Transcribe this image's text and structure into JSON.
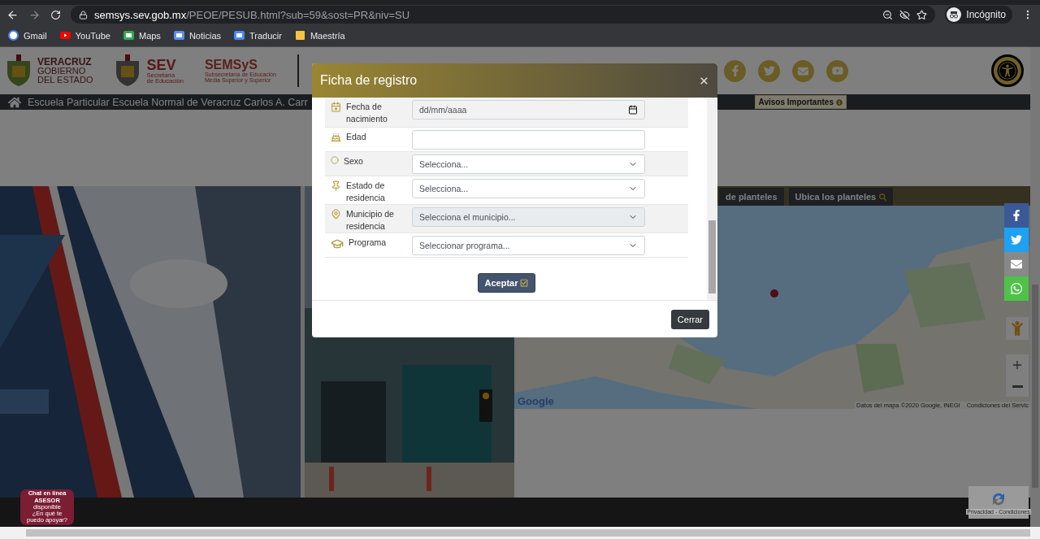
{
  "browser": {
    "url_host": "semsys.sev.gob.mx",
    "url_path": "/PEOE/PESUB.html?sub=59&sost=PR&niv=SU",
    "profile": "Incógnito",
    "bookmarks": [
      "Gmail",
      "YouTube",
      "Maps",
      "Noticias",
      "Traducir",
      "Maestría"
    ]
  },
  "header": {
    "gov": {
      "title": "VERACRUZ",
      "lines": [
        "GOBIERNO",
        "DEL ESTADO"
      ]
    },
    "sev": {
      "title": "SEV",
      "lines": [
        "Secretaría",
        "de Educación"
      ]
    },
    "semsys": {
      "title": "SEMSyS",
      "lines": [
        "Subsecretaría de Educación",
        "Media Superior y Superior"
      ]
    }
  },
  "nav": {
    "school": "Escuela Particular Escuela Normal de Veracruz Carlos A. Carr",
    "notice": "Avisos Importantes"
  },
  "map": {
    "tabs": [
      "de planteles",
      "Ubica los planteles"
    ],
    "logo": "Google",
    "attribution": "Datos del mapa ©2020 Google, INEGI",
    "terms": "Condiciones del Servic"
  },
  "modal": {
    "title": "Ficha de registro",
    "fields": [
      {
        "kind": "date",
        "label": "Fecha de nacimiento",
        "placeholder": "dd/mm/aaaa"
      },
      {
        "kind": "text",
        "label": "Edad"
      },
      {
        "kind": "select",
        "label": "Sexo",
        "value": "Selecciona...",
        "disabled": false
      },
      {
        "kind": "select",
        "label": "Estado de residencia",
        "value": "Selecciona...",
        "disabled": false
      },
      {
        "kind": "select",
        "label": "Municipio de residencia",
        "value": "Selecciona el municipio...",
        "disabled": true
      },
      {
        "kind": "select",
        "label": "Programa",
        "value": "Seleccionar programa...",
        "disabled": false
      }
    ],
    "submit": "Aceptar",
    "close": "Cerrar"
  },
  "chat": {
    "lines": [
      "**Chat en línea**",
      "**ASESOR**",
      "disponible",
      "¿En qué te",
      "puedo apoyar?"
    ]
  },
  "recaptcha": "Privacidad - Condiciones"
}
